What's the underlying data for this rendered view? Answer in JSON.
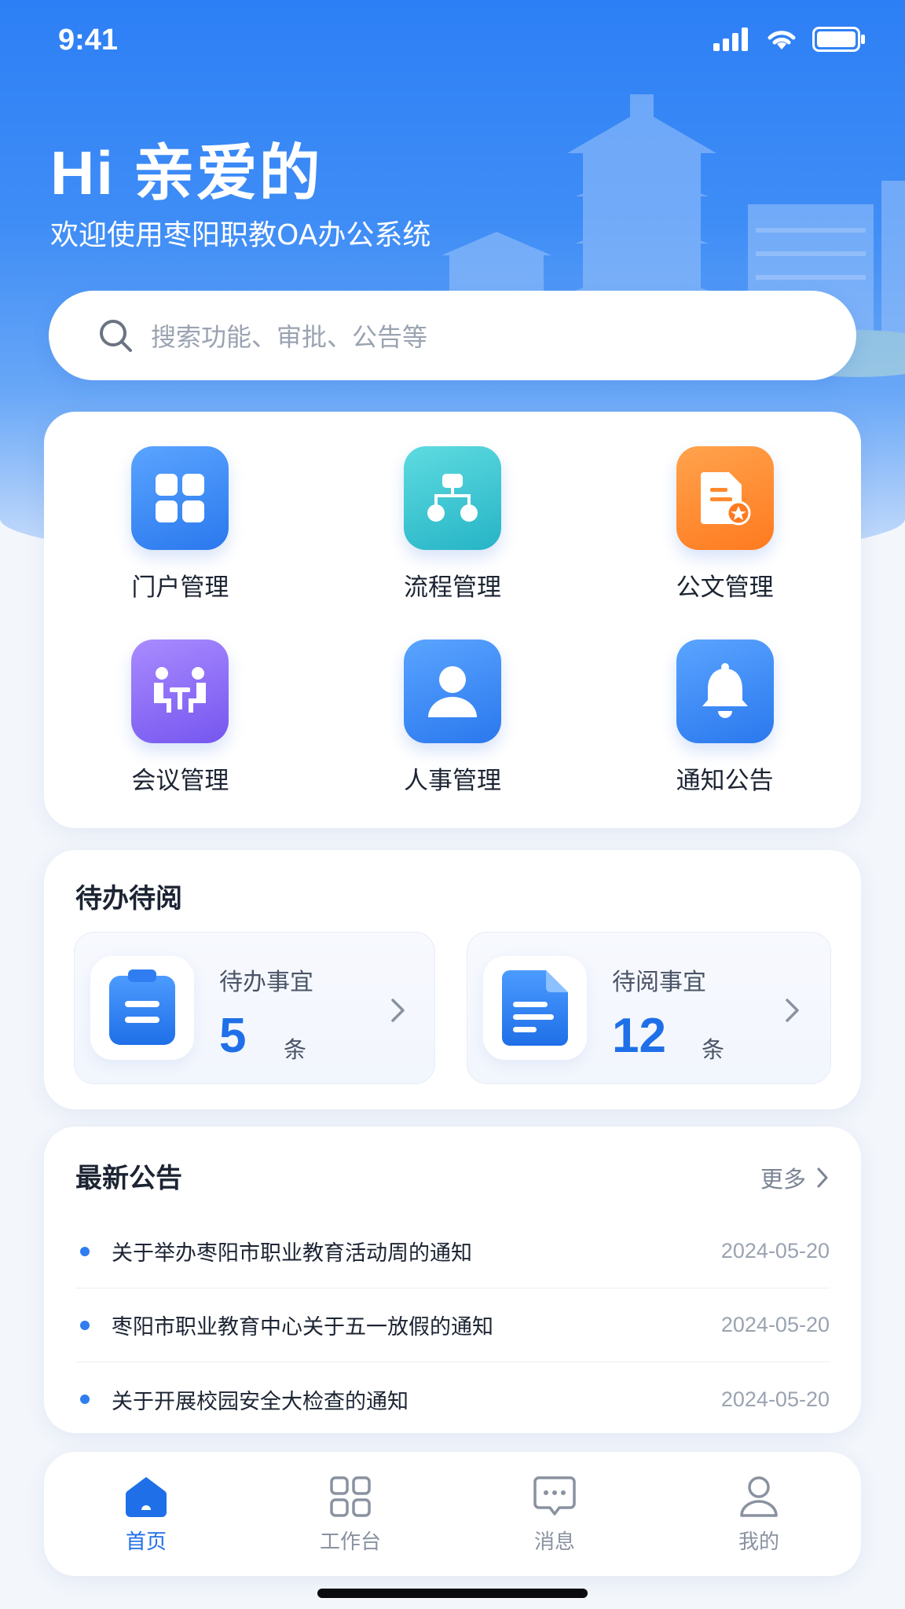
{
  "status_bar": {
    "time": "9:41"
  },
  "header": {
    "greeting": "Hi 亲爱的",
    "welcome": "欢迎使用枣阳职教OA办公系统"
  },
  "search": {
    "placeholder": "搜索功能、审批、公告等"
  },
  "quick_menu": [
    {
      "label": "门户管理",
      "icon": "grid-icon",
      "color": "#2a78ee"
    },
    {
      "label": "流程管理",
      "icon": "org-chart-icon",
      "color": "#26b4c6"
    },
    {
      "label": "公文管理",
      "icon": "document-seal-icon",
      "color": "#ff7a1f"
    },
    {
      "label": "会议管理",
      "icon": "meeting-icon",
      "color": "#7556ef"
    },
    {
      "label": "人事管理",
      "icon": "person-icon",
      "color": "#2a78ee"
    },
    {
      "label": "通知公告",
      "icon": "bell-icon",
      "color": "#2a78ee"
    }
  ],
  "todo": {
    "title": "待办待阅",
    "items": [
      {
        "label": "待办事宜",
        "count": "5",
        "unit": "条",
        "icon": "clipboard-icon"
      },
      {
        "label": "待阅事宜",
        "count": "12",
        "unit": "条",
        "icon": "file-icon"
      }
    ]
  },
  "news": {
    "title": "最新公告",
    "more": "更多",
    "items": [
      {
        "title": "关于举办枣阳市职业教育活动周的通知",
        "date": "2024-05-20"
      },
      {
        "title": "枣阳市职业教育中心关于五一放假的通知",
        "date": "2024-05-20"
      },
      {
        "title": "关于开展校园安全大检查的通知",
        "date": "2024-05-20"
      }
    ]
  },
  "tabbar": [
    {
      "label": "首页",
      "icon": "home-icon",
      "active": true
    },
    {
      "label": "工作台",
      "icon": "workbench-icon",
      "active": false
    },
    {
      "label": "消息",
      "icon": "message-icon",
      "active": false
    },
    {
      "label": "我的",
      "icon": "user-icon",
      "active": false
    }
  ],
  "colors": {
    "primary": "#1f6fe8",
    "hero": "#2d7ff5",
    "muted": "#9aa3b1"
  }
}
